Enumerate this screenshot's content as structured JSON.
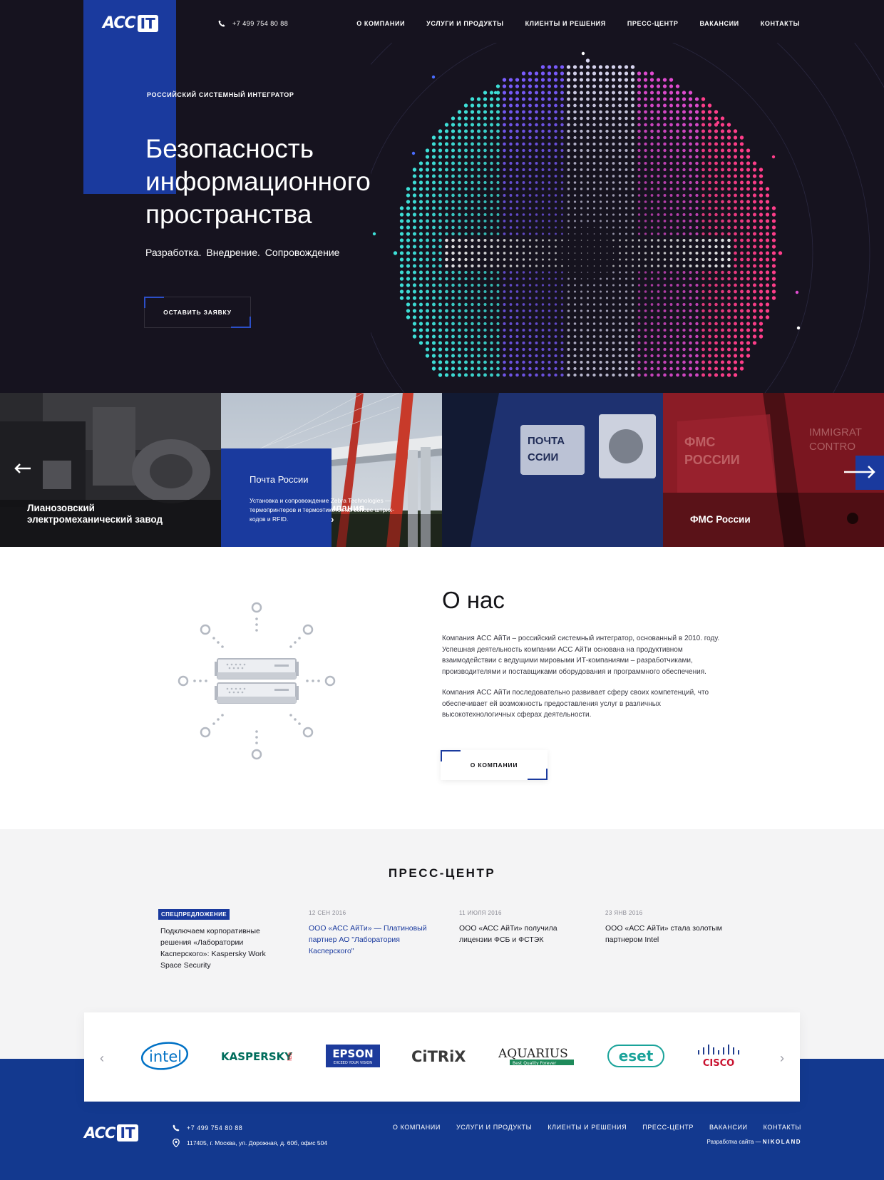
{
  "brand": {
    "logo_acc": "ACC",
    "logo_it": "IT"
  },
  "header": {
    "phone": "+7 499 754 80 88",
    "nav": [
      "О КОМПАНИИ",
      "УСЛУГИ И ПРОДУКТЫ",
      "КЛИЕНТЫ И РЕШЕНИЯ",
      "ПРЕСС-ЦЕНТР",
      "ВАКАНСИИ",
      "КОНТАКТЫ"
    ]
  },
  "hero": {
    "eyebrow": "РОССИЙСКИЙ СИСТЕМНЫЙ ИНТЕГРАТОР",
    "title": "Безопасность информационного пространства",
    "subtitle": "Разработка.  Внедрение.  Сопровождение",
    "cta": "ОСТАВИТЬ ЗАЯВКУ"
  },
  "cases": [
    {
      "title": "Лианозовский\nэлектромеханический завод"
    },
    {
      "title": "Управляющая компания\n«Альфа-Капитал»"
    },
    {
      "title": "Почта России",
      "description": "Установка и сопровождение Zebra Technologies — термопринтеров и термоэтикеток на основе штрих-кодов и RFID."
    },
    {
      "title": "ФМС России"
    }
  ],
  "about": {
    "title": "О нас",
    "p1": "Компания АСС АйТи – российский системный интегратор, основанный в 2010. году. Успешная деятельность компании АСС АйТи основана на продуктивном взаимодействии с ведущими мировыми ИТ-компаниями – разработчиками, производителями и поставщиками оборудования и программного обеспечения.",
    "p2": "Компания АСС АйТи последовательно развивает сферу своих компетенций, что обеспечивает ей возможность предоставления услуг в различных высокотехнологичных сферах деятельности.",
    "button": "О КОМПАНИИ"
  },
  "press": {
    "title": "ПРЕСС-ЦЕНТР",
    "items": [
      {
        "badge": "СПЕЦПРЕДЛОЖЕНИЕ",
        "date": "",
        "text": "Подключаем корпоративные решения «Лаборатории Касперского»: Kaspersky Work Space Security"
      },
      {
        "badge": "",
        "date": "12 СЕН 2016",
        "text": "ООО «АСС АйТи» — Платиновый партнер АО \"Лаборатория Касперского\""
      },
      {
        "badge": "",
        "date": "11 ИЮЛЯ 2016",
        "text": "ООО «АСС АйТи» получила лицензии ФСБ и ФСТЭК"
      },
      {
        "badge": "",
        "date": "23 ЯНВ 2016",
        "text": "ООО «АСС АйТи» стала золотым партнером Intel"
      }
    ]
  },
  "partners": {
    "intel": "intel",
    "kaspersky": "KASPERSKY",
    "kaspersky_lab": "lab",
    "epson": "EPSON",
    "epson_tag": "EXCEED YOUR VISION",
    "citrix": "CiTRiX",
    "aquarius": "AQUARIUS",
    "aquarius_tag": "Best Quality Forever",
    "eset": "eset",
    "cisco": "CISCO",
    "prev": "‹",
    "next": "›"
  },
  "footer": {
    "phone": "+7 499 754 80 88",
    "address": "117405, г. Москва, ул. Дорожная, д. 60б, офис 504",
    "nav": [
      "О КОМПАНИИ",
      "УСЛУГИ И ПРОДУКТЫ",
      "КЛИЕНТЫ И РЕШЕНИЯ",
      "ПРЕСС-ЦЕНТР",
      "ВАКАНСИИ",
      "КОНТАКТЫ"
    ],
    "dev_label": "Разработка сайта —",
    "dev_name": "NIKOLAND"
  },
  "colors": {
    "brand_blue": "#1a3a9e",
    "hero_bg": "#16131f",
    "footer_blue": "#13398f"
  }
}
